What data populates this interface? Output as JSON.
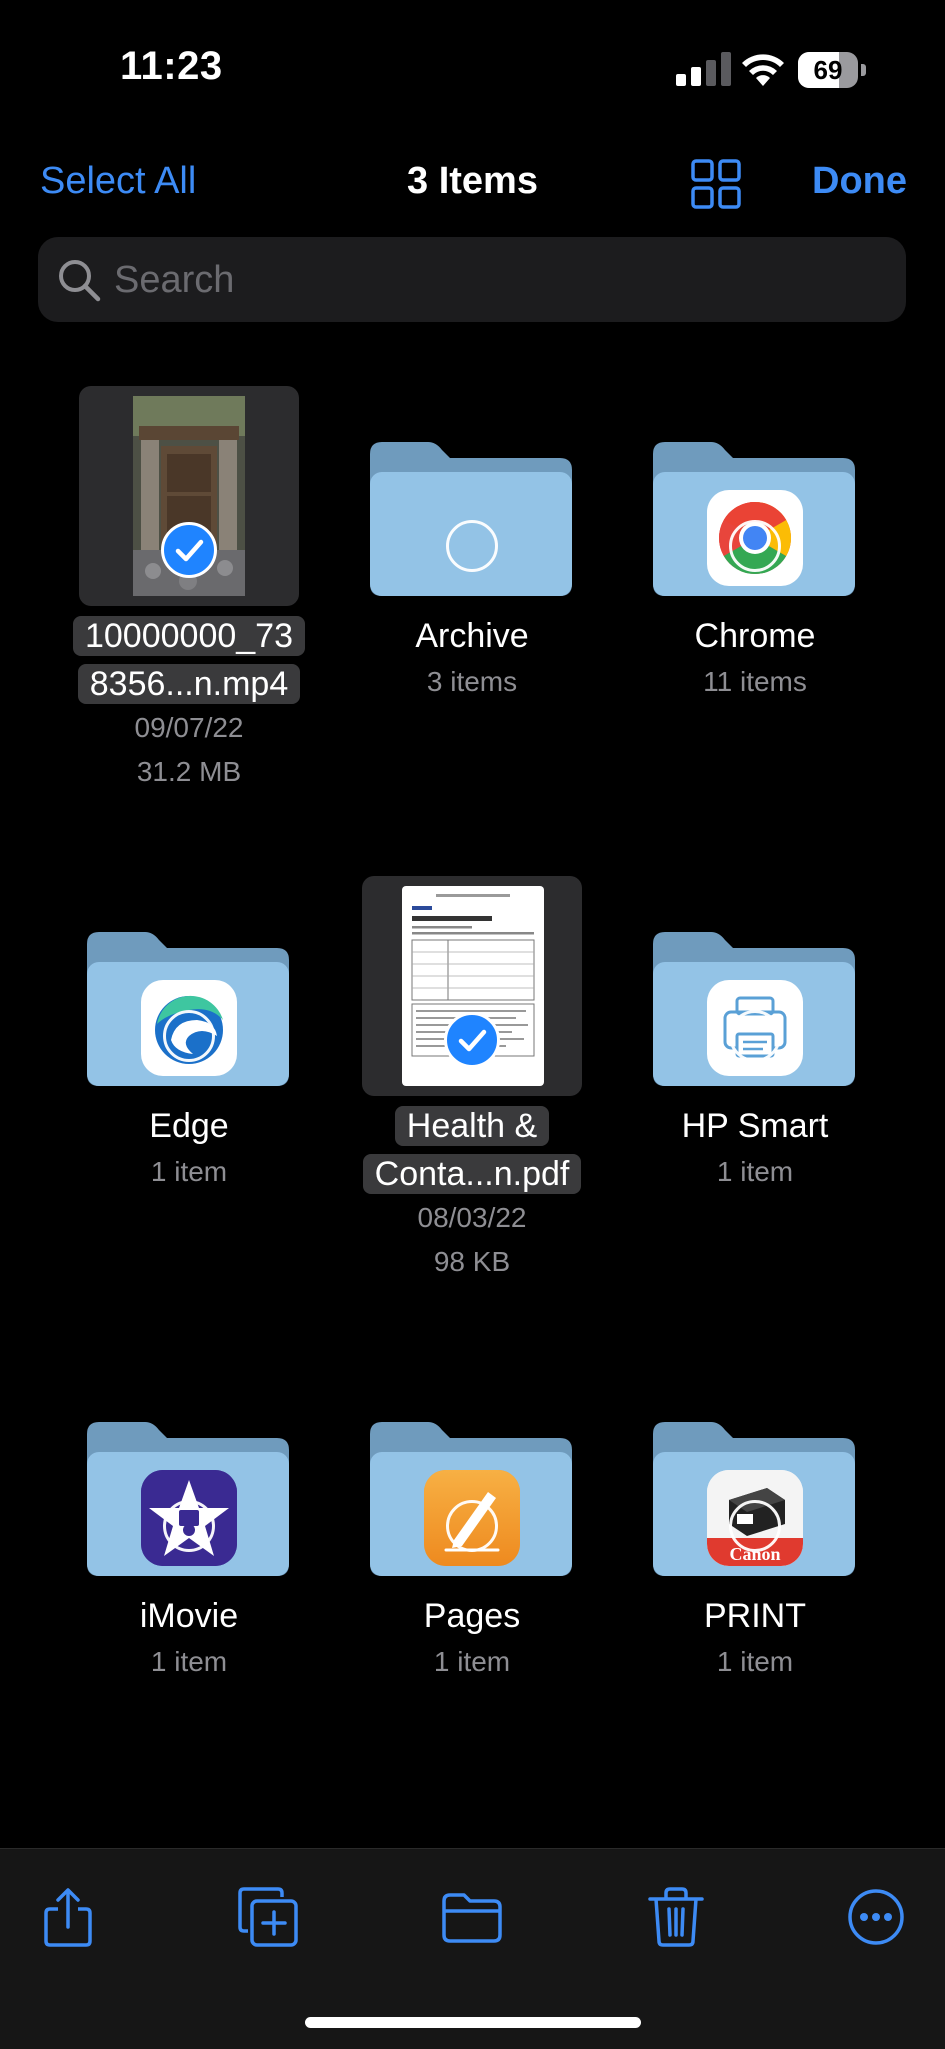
{
  "status_bar": {
    "time": "11:23",
    "battery_level": "69",
    "battery_fraction": 0.69
  },
  "nav": {
    "select_all_label": "Select All",
    "title": "3 Items",
    "done_label": "Done"
  },
  "search": {
    "placeholder": "Search"
  },
  "items": [
    {
      "name_line1": "10000000_73",
      "name_line2": "8356...n.mp4",
      "date": "09/07/22",
      "size": "31.2 MB",
      "selected": true,
      "kind": "video"
    },
    {
      "name": "Archive",
      "count": "3 items",
      "selected": false,
      "kind": "folder"
    },
    {
      "name": "Chrome",
      "count": "11 items",
      "selected": false,
      "kind": "folder",
      "icon": "chrome-icon"
    },
    {
      "name": "Edge",
      "count": "1 item",
      "selected": false,
      "kind": "folder",
      "icon": "edge-icon"
    },
    {
      "name_line1": "Health &",
      "name_line2": "Conta...n.pdf",
      "date": "08/03/22",
      "size": "98 KB",
      "selected": true,
      "kind": "pdf",
      "doc_title": "Self-health declaration form"
    },
    {
      "name": "HP Smart",
      "count": "1 item",
      "selected": false,
      "kind": "folder",
      "icon": "hp-smart-icon"
    },
    {
      "name": "iMovie",
      "count": "1 item",
      "selected": false,
      "kind": "folder",
      "icon": "imovie-icon"
    },
    {
      "name": "Pages",
      "count": "1 item",
      "selected": false,
      "kind": "folder",
      "icon": "pages-icon"
    },
    {
      "name": "PRINT",
      "count": "1 item",
      "selected": false,
      "kind": "folder",
      "icon": "canon-icon",
      "logo_text": "Canon"
    }
  ],
  "toolbar": {
    "buttons": [
      "share-icon",
      "duplicate-icon",
      "move-folder-icon",
      "trash-icon",
      "more-icon"
    ]
  },
  "colors": {
    "accent": "#3d8bf5",
    "folder": "#93c3e6",
    "background": "#000000",
    "check": "#1f84ff"
  }
}
